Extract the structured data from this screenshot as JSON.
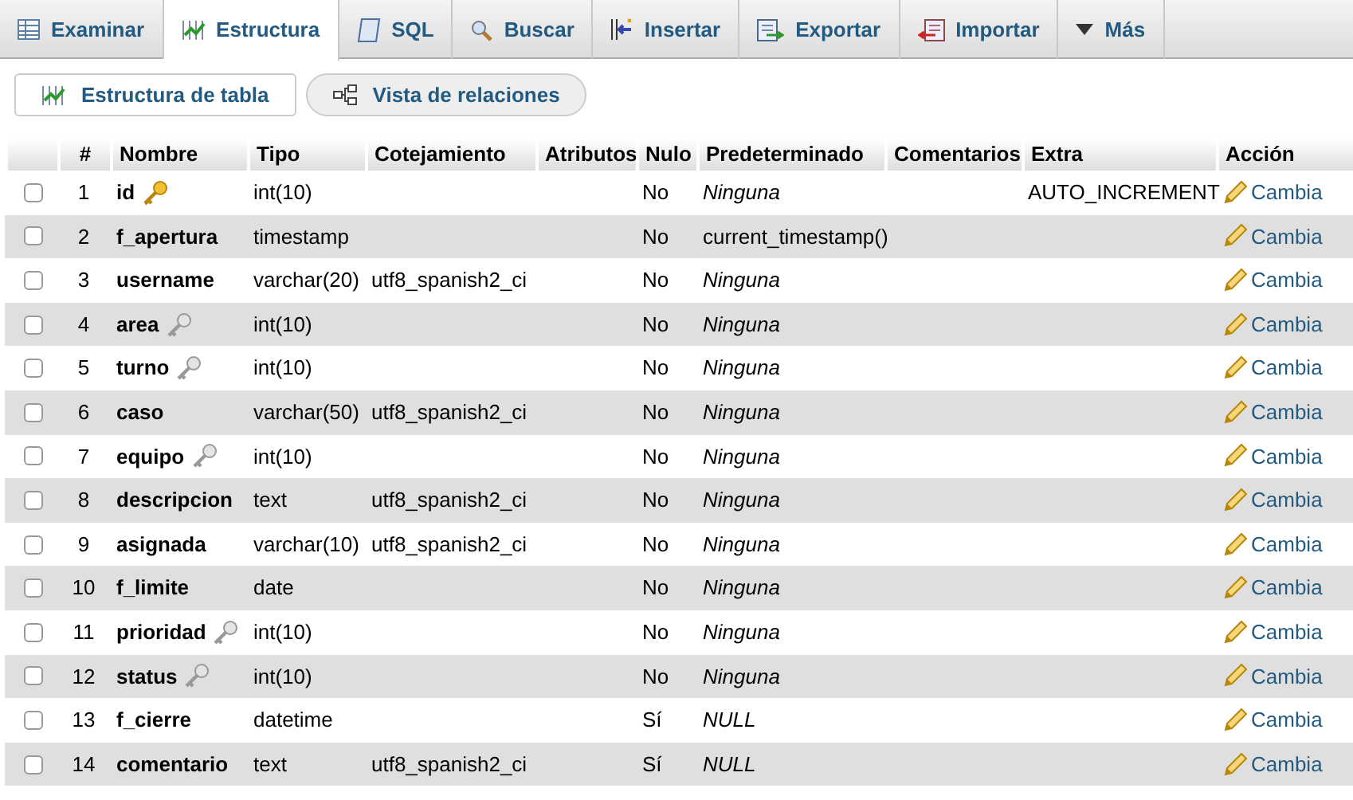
{
  "tabs": [
    {
      "label": "Examinar",
      "selected": false
    },
    {
      "label": "Estructura",
      "selected": true
    },
    {
      "label": "SQL",
      "selected": false
    },
    {
      "label": "Buscar",
      "selected": false
    },
    {
      "label": "Insertar",
      "selected": false
    },
    {
      "label": "Exportar",
      "selected": false
    },
    {
      "label": "Importar",
      "selected": false
    },
    {
      "label": "Más",
      "selected": false
    }
  ],
  "subtabs": [
    {
      "label": "Estructura de tabla",
      "selected": true
    },
    {
      "label": "Vista de relaciones",
      "selected": false
    }
  ],
  "table": {
    "columns": [
      "#",
      "Nombre",
      "Tipo",
      "Cotejamiento",
      "Atributos",
      "Nulo",
      "Predeterminado",
      "Comentarios",
      "Extra",
      "Acción"
    ],
    "rows": [
      {
        "checked": false,
        "num": "1",
        "name": "id",
        "primary_key": true,
        "type": "int(10)",
        "collation": "",
        "null": "No",
        "default": "Ninguna",
        "default_italic": true,
        "extra": "AUTO_INCREMENT",
        "action": "Cambia"
      },
      {
        "checked": false,
        "num": "2",
        "name": "f_apertura",
        "primary_key": false,
        "indexed": false,
        "type": "timestamp",
        "collation": "",
        "null": "No",
        "default": "current_timestamp()",
        "default_italic": false,
        "extra": "",
        "action": "Cambia"
      },
      {
        "checked": false,
        "num": "3",
        "name": "username",
        "primary_key": false,
        "indexed": false,
        "type": "varchar(20)",
        "collation": "utf8_spanish2_ci",
        "null": "No",
        "default": "Ninguna",
        "default_italic": true,
        "extra": "",
        "action": "Cambia"
      },
      {
        "checked": false,
        "num": "4",
        "name": "area",
        "primary_key": false,
        "indexed": true,
        "type": "int(10)",
        "collation": "",
        "null": "No",
        "default": "Ninguna",
        "default_italic": true,
        "extra": "",
        "action": "Cambia"
      },
      {
        "checked": false,
        "num": "5",
        "name": "turno",
        "primary_key": false,
        "indexed": true,
        "type": "int(10)",
        "collation": "",
        "null": "No",
        "default": "Ninguna",
        "default_italic": true,
        "extra": "",
        "action": "Cambia"
      },
      {
        "checked": false,
        "num": "6",
        "name": "caso",
        "primary_key": false,
        "indexed": false,
        "type": "varchar(50)",
        "collation": "utf8_spanish2_ci",
        "null": "No",
        "default": "Ninguna",
        "default_italic": true,
        "extra": "",
        "action": "Cambia"
      },
      {
        "checked": false,
        "num": "7",
        "name": "equipo",
        "primary_key": false,
        "indexed": true,
        "type": "int(10)",
        "collation": "",
        "null": "No",
        "default": "Ninguna",
        "default_italic": true,
        "extra": "",
        "action": "Cambia"
      },
      {
        "checked": false,
        "num": "8",
        "name": "descripcion",
        "primary_key": false,
        "indexed": false,
        "type": "text",
        "collation": "utf8_spanish2_ci",
        "null": "No",
        "default": "Ninguna",
        "default_italic": true,
        "extra": "",
        "action": "Cambia"
      },
      {
        "checked": false,
        "num": "9",
        "name": "asignada",
        "primary_key": false,
        "indexed": false,
        "type": "varchar(10)",
        "collation": "utf8_spanish2_ci",
        "null": "No",
        "default": "Ninguna",
        "default_italic": true,
        "extra": "",
        "action": "Cambia"
      },
      {
        "checked": false,
        "num": "10",
        "name": "f_limite",
        "primary_key": false,
        "indexed": false,
        "type": "date",
        "collation": "",
        "null": "No",
        "default": "Ninguna",
        "default_italic": true,
        "extra": "",
        "action": "Cambia"
      },
      {
        "checked": false,
        "num": "11",
        "name": "prioridad",
        "primary_key": false,
        "indexed": true,
        "type": "int(10)",
        "collation": "",
        "null": "No",
        "default": "Ninguna",
        "default_italic": true,
        "extra": "",
        "action": "Cambia"
      },
      {
        "checked": false,
        "num": "12",
        "name": "status",
        "primary_key": false,
        "indexed": true,
        "type": "int(10)",
        "collation": "",
        "null": "No",
        "default": "Ninguna",
        "default_italic": true,
        "extra": "",
        "action": "Cambia"
      },
      {
        "checked": false,
        "num": "13",
        "name": "f_cierre",
        "primary_key": false,
        "indexed": false,
        "type": "datetime",
        "collation": "",
        "null": "Sí",
        "default": "NULL",
        "default_italic": true,
        "extra": "",
        "action": "Cambia"
      },
      {
        "checked": false,
        "num": "14",
        "name": "comentario",
        "primary_key": false,
        "indexed": false,
        "type": "text",
        "collation": "utf8_spanish2_ci",
        "null": "Sí",
        "default": "NULL",
        "default_italic": true,
        "extra": "",
        "action": "Cambia"
      }
    ]
  }
}
